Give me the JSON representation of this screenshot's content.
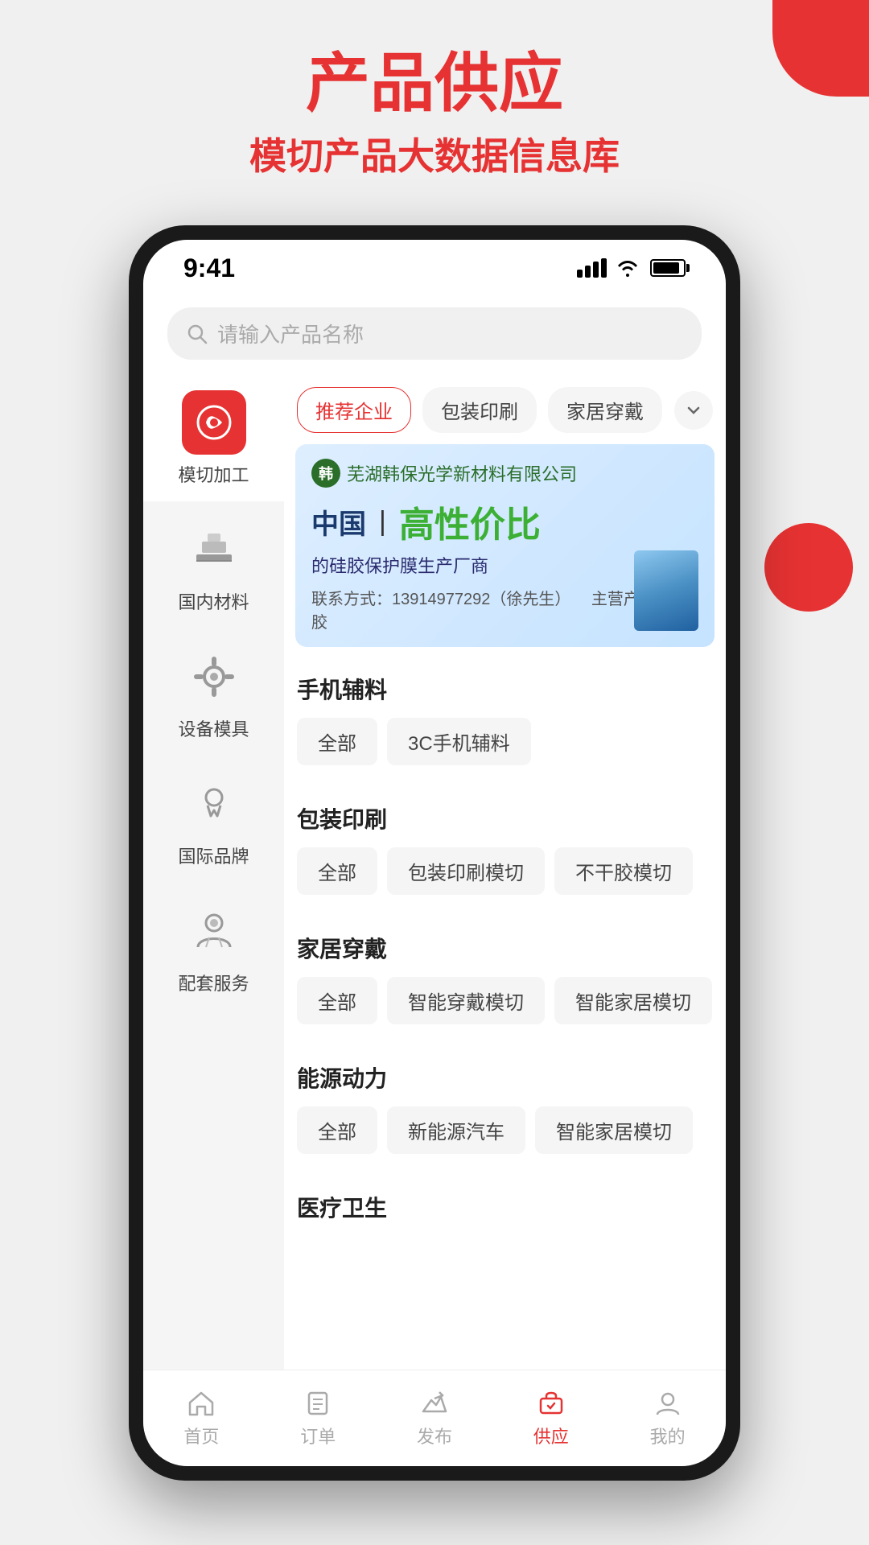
{
  "page": {
    "bg_title_main": "产品供应",
    "bg_title_sub": "模切产品大数据信息库"
  },
  "status_bar": {
    "time": "9:41"
  },
  "search": {
    "placeholder": "请输入产品名称"
  },
  "filter_tabs": [
    {
      "id": "recommended",
      "label": "推荐企业",
      "active": true
    },
    {
      "id": "packaging",
      "label": "包装印刷",
      "active": false
    },
    {
      "id": "home_wear",
      "label": "家居穿戴",
      "active": false
    }
  ],
  "banner": {
    "company_name": "芜湖韩保光学新材料有限公司",
    "china_text": "中国",
    "highlight_text": "高性价比",
    "sub_text": "的硅胶保护膜生产厂商",
    "contact": "联系方式：13914977292（徐先生）",
    "main_product": "主营产品：硅胶"
  },
  "sidebar": {
    "items": [
      {
        "id": "die_cutting",
        "label": "模切加工",
        "active": true,
        "icon": "wrench"
      },
      {
        "id": "domestic_materials",
        "label": "国内材料",
        "active": false,
        "icon": "layers"
      },
      {
        "id": "equipment_mold",
        "label": "设备模具",
        "active": false,
        "icon": "gear"
      },
      {
        "id": "international_brand",
        "label": "国际品牌",
        "active": false,
        "icon": "medal"
      },
      {
        "id": "support_service",
        "label": "配套服务",
        "active": false,
        "icon": "service"
      }
    ]
  },
  "categories": [
    {
      "id": "mobile_accessories",
      "title": "手机辅料",
      "tags": [
        "全部",
        "3C手机辅料"
      ]
    },
    {
      "id": "packaging_print",
      "title": "包装印刷",
      "tags": [
        "全部",
        "包装印刷模切",
        "不干胶模切"
      ]
    },
    {
      "id": "home_wear",
      "title": "家居穿戴",
      "tags": [
        "全部",
        "智能穿戴模切",
        "智能家居模切"
      ]
    },
    {
      "id": "energy_power",
      "title": "能源动力",
      "tags": [
        "全部",
        "新能源汽车",
        "智能家居模切"
      ]
    },
    {
      "id": "medical",
      "title": "医疗卫生",
      "tags": []
    }
  ],
  "bottom_nav": [
    {
      "id": "home",
      "label": "首页",
      "active": false,
      "icon": "home"
    },
    {
      "id": "orders",
      "label": "订单",
      "active": false,
      "icon": "orders"
    },
    {
      "id": "publish",
      "label": "发布",
      "active": false,
      "icon": "publish"
    },
    {
      "id": "supply",
      "label": "供应",
      "active": true,
      "icon": "supply"
    },
    {
      "id": "mine",
      "label": "我的",
      "active": false,
      "icon": "user"
    }
  ]
}
